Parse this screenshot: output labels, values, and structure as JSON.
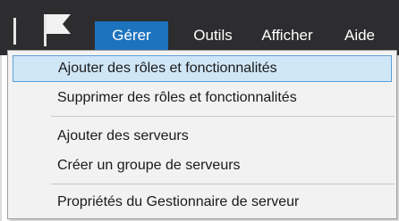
{
  "menu": {
    "items": [
      {
        "label": "Gérer",
        "active": true
      },
      {
        "label": "Outils",
        "active": false
      },
      {
        "label": "Afficher",
        "active": false
      },
      {
        "label": "Aide",
        "active": false
      }
    ]
  },
  "dropdown": {
    "groups": [
      [
        "Ajouter des rôles et fonctionnalités",
        "Supprimer des rôles et fonctionnalités"
      ],
      [
        "Ajouter des serveurs",
        "Créer un groupe de serveurs"
      ],
      [
        "Propriétés du Gestionnaire de serveur"
      ]
    ],
    "highlighted": "Ajouter des rôles et fonctionnalités"
  },
  "colors": {
    "titlebar": "#2d2d30",
    "active_menu": "#1e73be",
    "highlight_bg": "#cfe6f7",
    "highlight_border": "#5aa0d8"
  },
  "icons": {
    "flag": "notification-flag-icon"
  }
}
